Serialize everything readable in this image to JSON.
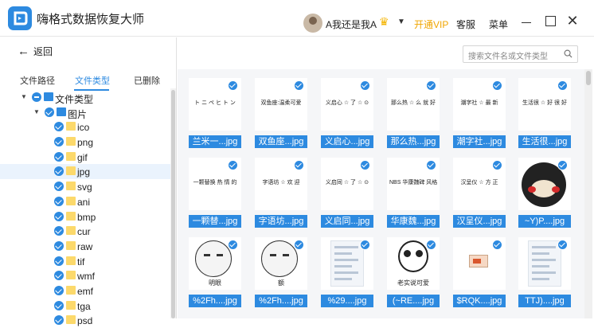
{
  "app": {
    "title": "嗨格式数据恢复大师",
    "user_name": "A我还是我A",
    "vip_label": "开通VIP",
    "service_label": "客服",
    "menu_label": "菜单"
  },
  "toolbar": {
    "back_label": "返回"
  },
  "search": {
    "placeholder": "搜索文件名或文件类型"
  },
  "tabs": [
    {
      "label": "文件路径",
      "active": false
    },
    {
      "label": "文件类型",
      "active": true
    },
    {
      "label": "已删除",
      "active": false
    }
  ],
  "tree": [
    {
      "label": "文件类型",
      "level": 0,
      "toggle": "▼",
      "check": "partial",
      "folder": "blue"
    },
    {
      "label": "图片",
      "level": 1,
      "toggle": "▼",
      "check": "checked",
      "folder": "blue"
    },
    {
      "label": "ico",
      "level": 2,
      "check": "checked",
      "folder": "yellow"
    },
    {
      "label": "png",
      "level": 2,
      "check": "checked",
      "folder": "yellow"
    },
    {
      "label": "gif",
      "level": 2,
      "check": "checked",
      "folder": "yellow"
    },
    {
      "label": "jpg",
      "level": 2,
      "check": "checked",
      "folder": "yellow",
      "selected": true
    },
    {
      "label": "svg",
      "level": 2,
      "check": "checked",
      "folder": "yellow"
    },
    {
      "label": "ani",
      "level": 2,
      "check": "checked",
      "folder": "yellow"
    },
    {
      "label": "bmp",
      "level": 2,
      "check": "checked",
      "folder": "yellow"
    },
    {
      "label": "cur",
      "level": 2,
      "check": "checked",
      "folder": "yellow"
    },
    {
      "label": "raw",
      "level": 2,
      "check": "checked",
      "folder": "yellow"
    },
    {
      "label": "tif",
      "level": 2,
      "check": "checked",
      "folder": "yellow"
    },
    {
      "label": "wmf",
      "level": 2,
      "check": "checked",
      "folder": "yellow"
    },
    {
      "label": "emf",
      "level": 2,
      "check": "checked",
      "folder": "yellow"
    },
    {
      "label": "tga",
      "level": 2,
      "check": "checked",
      "folder": "yellow"
    },
    {
      "label": "psd",
      "level": 2,
      "check": "checked",
      "folder": "yellow"
    }
  ],
  "files": [
    {
      "name": "兰米一...jpg",
      "thumb": "text",
      "thumb_text": "ト ニ ペ ヒ ト ン"
    },
    {
      "name": "双鱼座...jpg",
      "thumb": "text",
      "thumb_text": "双鱼座:温柔可爱"
    },
    {
      "name": "义启心...jpg",
      "thumb": "text",
      "thumb_text": "义启心 ☆ 了 ☆ ⊙"
    },
    {
      "name": "那么热...jpg",
      "thumb": "text",
      "thumb_text": "那么热 ☆ 么 就 好"
    },
    {
      "name": "潮字社...jpg",
      "thumb": "text",
      "thumb_text": "潮字社 ☆ 最 新"
    },
    {
      "name": "生活很...jpg",
      "thumb": "text",
      "thumb_text": "生活很 ☆ 好 很 好"
    },
    {
      "name": "一颗替...jpg",
      "thumb": "text",
      "thumb_text": "一颗替换 热 情 的"
    },
    {
      "name": "字语坊...jpg",
      "thumb": "text",
      "thumb_text": "字语坊 ☆ 欢 迎"
    },
    {
      "name": "义启同...jpg",
      "thumb": "text",
      "thumb_text": "义启同 ☆ 了 ☆ ⊙"
    },
    {
      "name": "华康魏...jpg",
      "thumb": "text",
      "thumb_text": "NBS 华康魏碑 风格"
    },
    {
      "name": "汉呈仪...jpg",
      "thumb": "text",
      "thumb_text": "汉呈仪 ☆ 方 正"
    },
    {
      "name": "~Y)P....jpg",
      "thumb": "bear",
      "thumb_text": ""
    },
    {
      "name": "%2Fh....jpg",
      "thumb": "meme",
      "thumb_text": "明眼"
    },
    {
      "name": "%2Fh....jpg",
      "thumb": "meme",
      "thumb_text": "额"
    },
    {
      "name": "%29....jpg",
      "thumb": "phone",
      "thumb_text": ""
    },
    {
      "name": "(~RE....jpg",
      "thumb": "panda",
      "thumb_text": "老实说可爱"
    },
    {
      "name": "$RQK....jpg",
      "thumb": "card",
      "thumb_text": ""
    },
    {
      "name": "TTJ)....jpg",
      "thumb": "phone",
      "thumb_text": ""
    }
  ],
  "colors": {
    "accent": "#2d8ae0",
    "vip": "#f0a500",
    "folder": "#fcd96b"
  }
}
